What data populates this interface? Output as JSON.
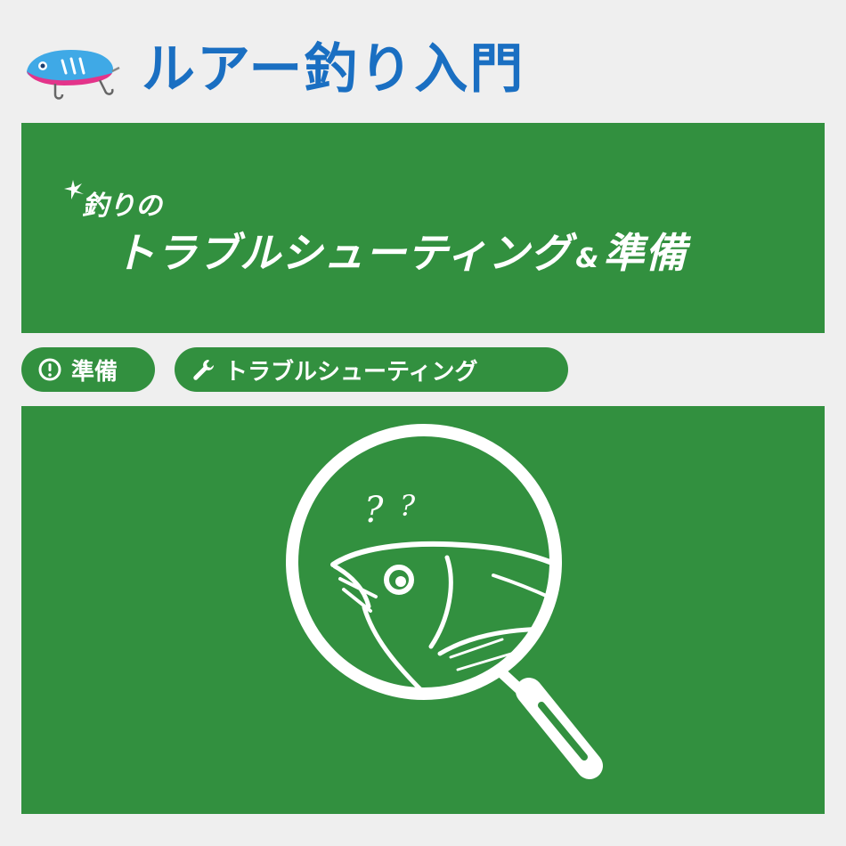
{
  "header": {
    "title": "ルアー釣り入門",
    "logo_icon": "fishing-lure-icon"
  },
  "banner": {
    "subtitle": "釣りの",
    "title_main": "トラブルシューティング",
    "title_amp": "&",
    "title_end": "準備"
  },
  "tags": [
    {
      "label": "準備",
      "icon": "exclamation-circle-icon"
    },
    {
      "label": "トラブルシューティング",
      "icon": "wrench-icon"
    }
  ],
  "hero": {
    "icon": "magnifier-fish-icon",
    "marks": "? ?"
  },
  "colors": {
    "accent_green": "#32903f",
    "title_blue": "#1a6fc2",
    "background": "#efefef"
  }
}
